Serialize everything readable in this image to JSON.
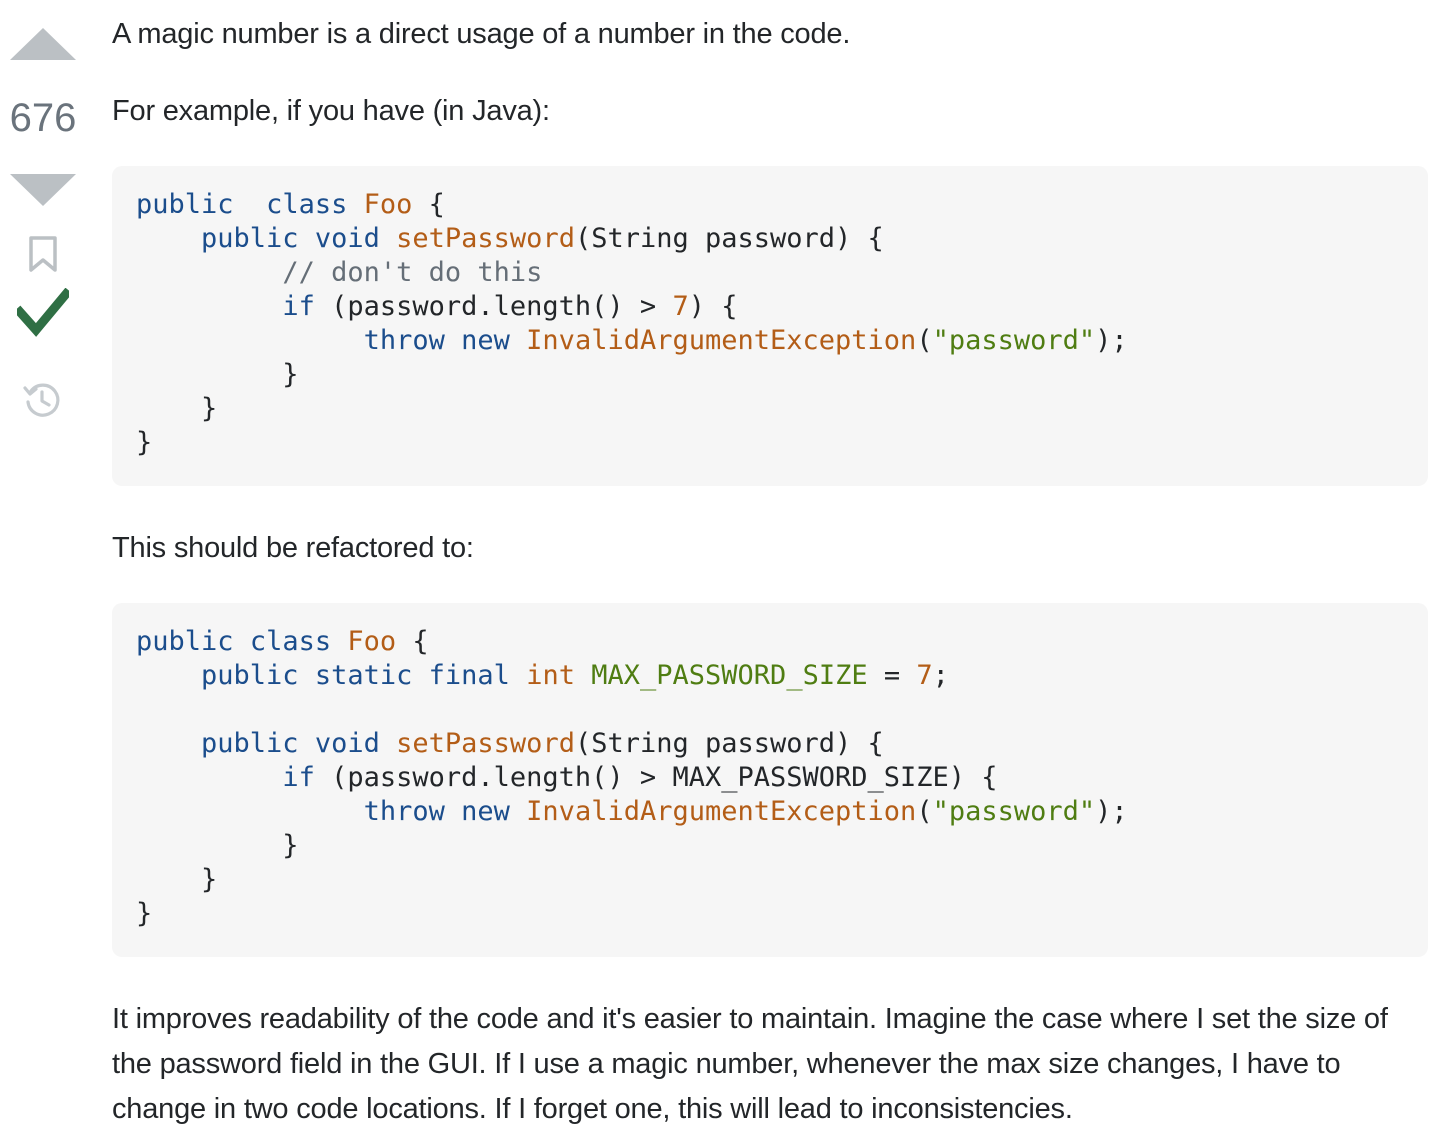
{
  "vote": {
    "count": "676"
  },
  "colors": {
    "accepted": "#2f6f44",
    "vote_arrow": "#bbc0c4",
    "code_bg": "#f6f6f6",
    "keyword": "#1b4d8c",
    "identifier": "#b35d17",
    "string": "#4f7d12",
    "comment": "#656e77"
  },
  "icons": {
    "upvote": "upvote-arrow-icon",
    "downvote": "downvote-arrow-icon",
    "bookmark": "bookmark-icon",
    "accepted": "checkmark-icon",
    "history": "history-icon"
  },
  "answer": {
    "p1": "A magic number is a direct usage of a number in the code.",
    "p2": "For example, if you have (in Java):",
    "p3": "This should be refactored to:",
    "p4": "It improves readability of the code and it's easier to maintain. Imagine the case where I set the size of the password field in the GUI. If I use a magic number, whenever the max size changes, I have to change in two code locations. If I forget one, this will lead to inconsistencies."
  },
  "code1": [
    [
      [
        "kw",
        "public"
      ],
      [
        "",
        "  "
      ],
      [
        "kw",
        "class"
      ],
      [
        "",
        " "
      ],
      [
        "cls",
        "Foo"
      ],
      [
        "",
        " {"
      ]
    ],
    [
      [
        "",
        "    "
      ],
      [
        "kw",
        "public"
      ],
      [
        "",
        " "
      ],
      [
        "kw",
        "void"
      ],
      [
        "",
        " "
      ],
      [
        "fn",
        "setPassword"
      ],
      [
        "",
        "(String password) {"
      ]
    ],
    [
      [
        "",
        "         "
      ],
      [
        "cmt",
        "// don't do this"
      ]
    ],
    [
      [
        "",
        "         "
      ],
      [
        "kw",
        "if"
      ],
      [
        "",
        " (password.length() > "
      ],
      [
        "num",
        "7"
      ],
      [
        "",
        ") {"
      ]
    ],
    [
      [
        "",
        "              "
      ],
      [
        "kw",
        "throw"
      ],
      [
        "",
        " "
      ],
      [
        "kw",
        "new"
      ],
      [
        "",
        " "
      ],
      [
        "fn",
        "InvalidArgumentException"
      ],
      [
        "",
        "("
      ],
      [
        "str",
        "\"password\""
      ],
      [
        "",
        ");"
      ]
    ],
    [
      [
        "",
        "         }"
      ]
    ],
    [
      [
        "",
        "    }"
      ]
    ],
    [
      [
        "",
        "}"
      ]
    ]
  ],
  "code2": [
    [
      [
        "kw",
        "public"
      ],
      [
        "",
        " "
      ],
      [
        "kw",
        "class"
      ],
      [
        "",
        " "
      ],
      [
        "cls",
        "Foo"
      ],
      [
        "",
        " {"
      ]
    ],
    [
      [
        "",
        "    "
      ],
      [
        "kw",
        "public"
      ],
      [
        "",
        " "
      ],
      [
        "kw",
        "static"
      ],
      [
        "",
        " "
      ],
      [
        "kw",
        "final"
      ],
      [
        "",
        " "
      ],
      [
        "num",
        "int"
      ],
      [
        "",
        " "
      ],
      [
        "const",
        "MAX_PASSWORD_SIZE"
      ],
      [
        "",
        " = "
      ],
      [
        "num",
        "7"
      ],
      [
        "",
        ";"
      ]
    ],
    [
      [
        "",
        ""
      ]
    ],
    [
      [
        "",
        "    "
      ],
      [
        "kw",
        "public"
      ],
      [
        "",
        " "
      ],
      [
        "kw",
        "void"
      ],
      [
        "",
        " "
      ],
      [
        "fn",
        "setPassword"
      ],
      [
        "",
        "(String password) {"
      ]
    ],
    [
      [
        "",
        "         "
      ],
      [
        "kw",
        "if"
      ],
      [
        "",
        " (password.length() > MAX_PASSWORD_SIZE) {"
      ]
    ],
    [
      [
        "",
        "              "
      ],
      [
        "kw",
        "throw"
      ],
      [
        "",
        " "
      ],
      [
        "kw",
        "new"
      ],
      [
        "",
        " "
      ],
      [
        "fn",
        "InvalidArgumentException"
      ],
      [
        "",
        "("
      ],
      [
        "str",
        "\"password\""
      ],
      [
        "",
        ");"
      ]
    ],
    [
      [
        "",
        "         }"
      ]
    ],
    [
      [
        "",
        "    }"
      ]
    ],
    [
      [
        "",
        "}"
      ]
    ]
  ]
}
